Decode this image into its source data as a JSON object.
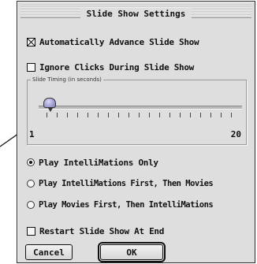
{
  "dialog": {
    "title": "Slide Show Settings",
    "auto_advance": {
      "label": "Automatically Advance Slide Show",
      "checked": true
    },
    "ignore_clicks": {
      "label": "Ignore Clicks During Slide Show",
      "checked": false
    },
    "timing": {
      "group_label": "Slide Timing (in seconds)",
      "min": "1",
      "max": "20",
      "value": 2
    },
    "play_options": [
      {
        "label": "Play IntelliMations Only",
        "selected": true
      },
      {
        "label": "Play IntelliMations First, Then Movies",
        "selected": false
      },
      {
        "label": "Play Movies First, Then IntelliMations",
        "selected": false
      }
    ],
    "restart": {
      "label": "Restart Slide Show At End",
      "checked": false
    },
    "buttons": {
      "cancel": "Cancel",
      "ok": "OK"
    }
  }
}
